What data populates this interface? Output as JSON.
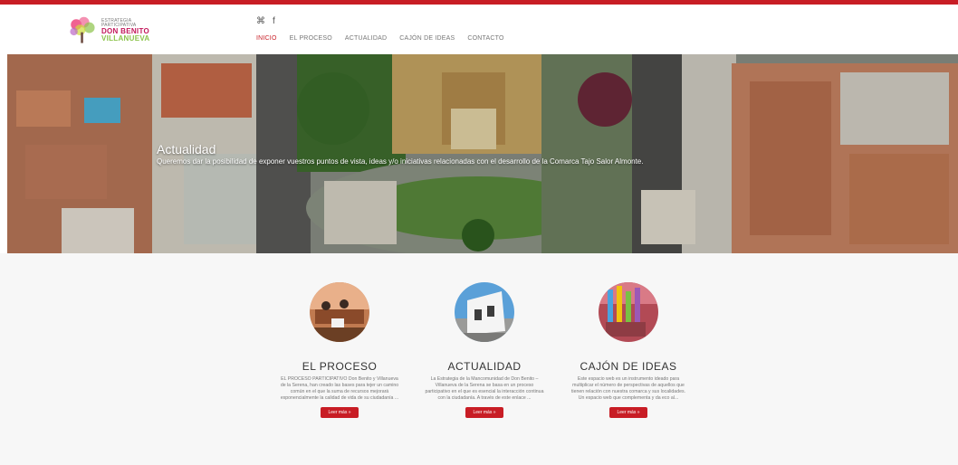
{
  "logo": {
    "small": "ESTRATEGIA PARTICIPATIVA",
    "top": "DON BENITO",
    "bottom": "VILLANUEVA"
  },
  "social": {
    "rss_glyph": "⌘",
    "facebook_glyph": "f"
  },
  "nav": {
    "items": [
      "INICIO",
      "EL PROCESO",
      "ACTUALIDAD",
      "CAJÓN DE IDEAS",
      "CONTACTO"
    ],
    "active_index": 0
  },
  "hero": {
    "title": "Actualidad",
    "subtitle": "Queremos dar la posibilidad de exponer vuestros puntos de vista, ideas y/o iniciativas relacionadas con el desarrollo de la Comarca Tajo Salor Almonte."
  },
  "cards": [
    {
      "title": "EL PROCESO",
      "text": "EL PROCESO PARTICIPATIVO Don Benito y Villanueva de la Serena, han creado las bases para tejer un camino común en el que la suma de recursos mejorará exponencialmente la calidad de vida de su ciudadanía ...",
      "button": "Leer más »"
    },
    {
      "title": "ACTUALIDAD",
      "text": "La Estrategia de la Mancomunidad de Don Benito – Villanueva de la Serena se basa en un proceso participativo en el que es esencial la interacción continua con la ciudadanía. A través de este enlace ...",
      "button": "Leer más »"
    },
    {
      "title": "CAJÓN DE IDEAS",
      "text": "Este espacio web es un instrumento ideado para multiplicar el número de perspectivas de aquellos que tienen relación con nuestra comarca y sus localidades. Un espacio web que complementa y da eco al...",
      "button": "Leer más »"
    }
  ],
  "colors": {
    "accent": "#c81d25"
  }
}
